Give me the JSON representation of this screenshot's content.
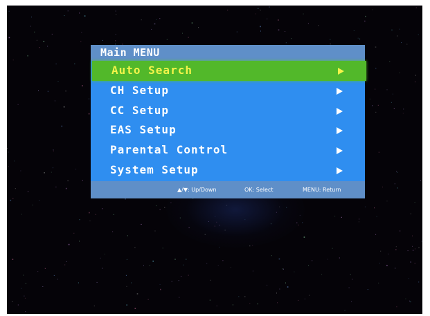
{
  "menu": {
    "title": "Main MENU",
    "items": [
      {
        "label": "Auto Search",
        "selected": true,
        "arrow": "right-arrow-icon"
      },
      {
        "label": "CH Setup",
        "selected": false,
        "arrow": "right-arrow-icon"
      },
      {
        "label": "CC Setup",
        "selected": false,
        "arrow": "right-arrow-icon"
      },
      {
        "label": "EAS Setup",
        "selected": false,
        "arrow": "right-arrow-icon"
      },
      {
        "label": "Parental Control",
        "selected": false,
        "arrow": "right-arrow-icon"
      },
      {
        "label": "System Setup",
        "selected": false,
        "arrow": "right-arrow-icon"
      }
    ]
  },
  "hints": {
    "navigate": "▲/▼: Up/Down",
    "ok": "OK: Select",
    "menu": "MENU: Return"
  },
  "colors": {
    "screen_background": "#050308",
    "menu_background": "#2f8ef0",
    "title_bar": "#5f8fc8",
    "selected_background": "#52b82a",
    "selected_text": "#f4f44a",
    "text": "#ffffff"
  }
}
